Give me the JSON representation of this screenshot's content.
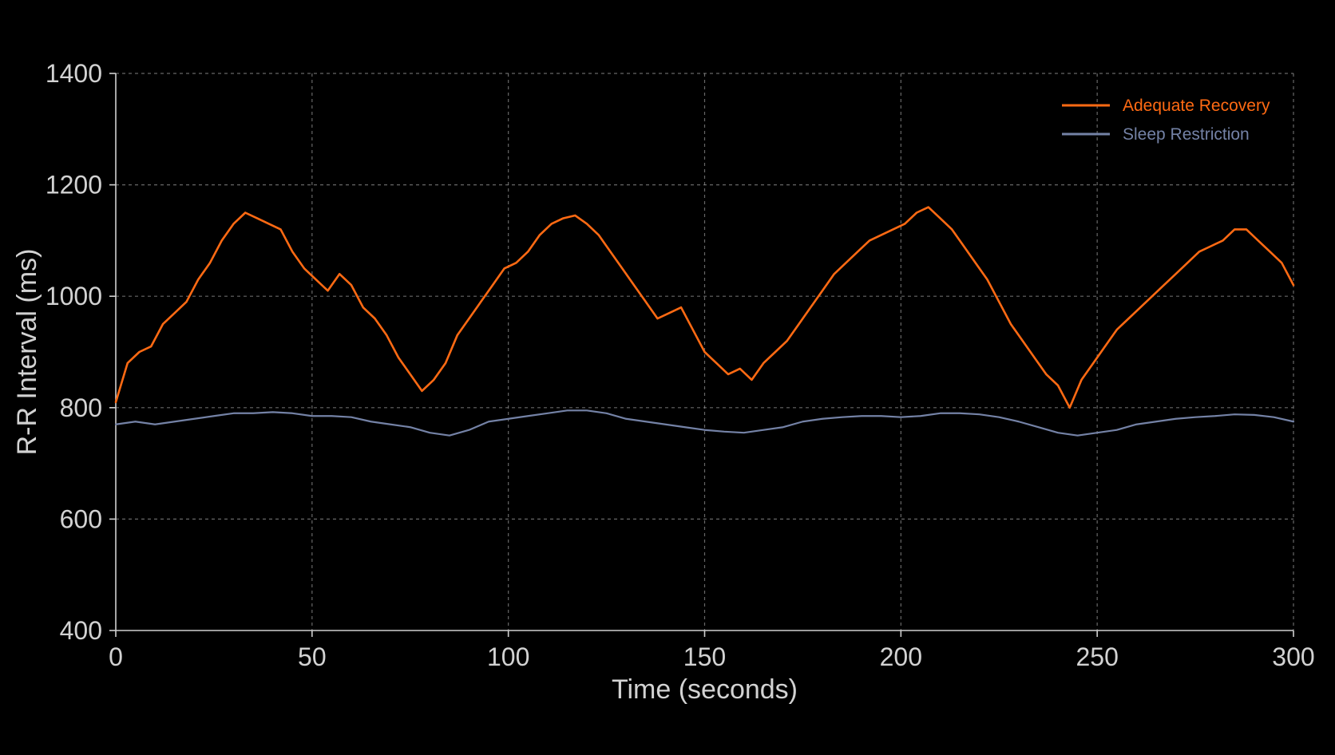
{
  "chart_data": {
    "type": "line",
    "title": "",
    "xlabel": "Time (seconds)",
    "ylabel": "R-R Interval (ms)",
    "xlim": [
      0,
      300
    ],
    "ylim": [
      400,
      1400
    ],
    "xticks": [
      0,
      50,
      100,
      150,
      200,
      250,
      300
    ],
    "yticks": [
      400,
      600,
      800,
      1000,
      1200,
      1400
    ],
    "xtick_labels": [
      "0",
      "50",
      "100",
      "150",
      "200",
      "250",
      "300"
    ],
    "ytick_labels": [
      "400",
      "600",
      "800",
      "1000",
      "1200",
      "1400"
    ],
    "grid": true,
    "legend_position": "top-right",
    "colors": {
      "background": "#000000",
      "adequate": "#ff6a13",
      "sleep": "#7482a6"
    },
    "series": [
      {
        "name": "Adequate Recovery",
        "x": [
          0,
          3,
          6,
          9,
          12,
          15,
          18,
          21,
          24,
          27,
          30,
          33,
          36,
          39,
          42,
          45,
          48,
          51,
          54,
          57,
          60,
          63,
          66,
          69,
          72,
          75,
          78,
          81,
          84,
          87,
          90,
          93,
          96,
          99,
          102,
          105,
          108,
          111,
          114,
          117,
          120,
          123,
          126,
          129,
          132,
          135,
          138,
          141,
          144,
          147,
          150,
          153,
          156,
          159,
          162,
          165,
          168,
          171,
          174,
          177,
          180,
          183,
          186,
          189,
          192,
          195,
          198,
          201,
          204,
          207,
          210,
          213,
          216,
          219,
          222,
          225,
          228,
          231,
          234,
          237,
          240,
          243,
          246,
          249,
          252,
          255,
          258,
          261,
          264,
          267,
          270,
          273,
          276,
          279,
          282,
          285,
          288,
          291,
          294,
          297,
          300
        ],
        "y": [
          810,
          880,
          900,
          910,
          950,
          970,
          990,
          1030,
          1060,
          1100,
          1130,
          1150,
          1140,
          1130,
          1120,
          1080,
          1050,
          1030,
          1010,
          1040,
          1020,
          980,
          960,
          930,
          890,
          860,
          830,
          850,
          880,
          930,
          960,
          990,
          1020,
          1050,
          1060,
          1080,
          1110,
          1130,
          1140,
          1145,
          1130,
          1110,
          1080,
          1050,
          1020,
          990,
          960,
          970,
          980,
          940,
          900,
          880,
          860,
          870,
          850,
          880,
          900,
          920,
          950,
          980,
          1010,
          1040,
          1060,
          1080,
          1100,
          1110,
          1120,
          1130,
          1150,
          1160,
          1140,
          1120,
          1090,
          1060,
          1030,
          990,
          950,
          920,
          890,
          860,
          840,
          800,
          850,
          880,
          910,
          940,
          960,
          980,
          1000,
          1020,
          1040,
          1060,
          1080,
          1090,
          1100,
          1120,
          1120,
          1100,
          1080,
          1060,
          1020
        ]
      },
      {
        "name": "Sleep Restriction",
        "x": [
          0,
          5,
          10,
          15,
          20,
          25,
          30,
          35,
          40,
          45,
          50,
          55,
          60,
          65,
          70,
          75,
          80,
          85,
          90,
          95,
          100,
          105,
          110,
          115,
          120,
          125,
          130,
          135,
          140,
          145,
          150,
          155,
          160,
          165,
          170,
          175,
          180,
          185,
          190,
          195,
          200,
          205,
          210,
          215,
          220,
          225,
          230,
          235,
          240,
          245,
          250,
          255,
          260,
          265,
          270,
          275,
          280,
          285,
          290,
          295,
          300
        ],
        "y": [
          770,
          775,
          770,
          775,
          780,
          785,
          790,
          790,
          792,
          790,
          785,
          785,
          783,
          775,
          770,
          765,
          755,
          750,
          760,
          775,
          780,
          785,
          790,
          795,
          795,
          790,
          780,
          775,
          770,
          765,
          760,
          757,
          755,
          760,
          765,
          775,
          780,
          783,
          785,
          785,
          783,
          785,
          790,
          790,
          788,
          783,
          775,
          765,
          755,
          750,
          755,
          760,
          770,
          775,
          780,
          783,
          785,
          788,
          787,
          783,
          775
        ]
      }
    ]
  }
}
